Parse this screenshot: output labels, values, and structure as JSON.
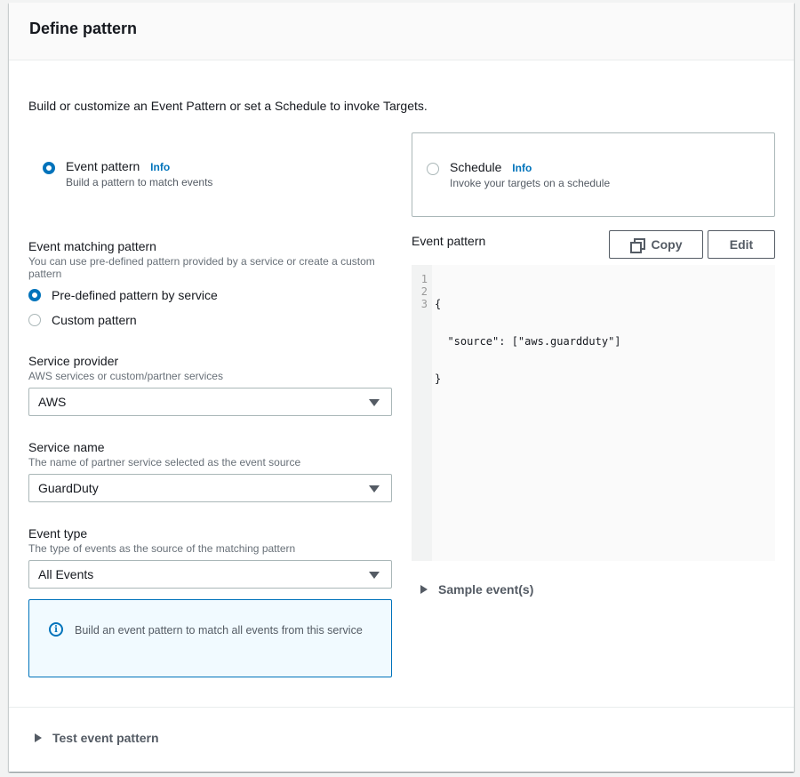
{
  "panel": {
    "title": "Define pattern",
    "intro": "Build or customize an Event Pattern or set a Schedule to invoke Targets."
  },
  "rule_type": {
    "options": [
      {
        "label": "Event pattern",
        "info": "Info",
        "description": "Build a pattern to match events",
        "selected": true
      },
      {
        "label": "Schedule",
        "info": "Info",
        "description": "Invoke your targets on a schedule",
        "selected": false
      }
    ]
  },
  "event_matching": {
    "label": "Event matching pattern",
    "description": "You can use pre-defined pattern provided by a service or create a custom pattern",
    "options": [
      {
        "label": "Pre-defined pattern by service",
        "selected": true
      },
      {
        "label": "Custom pattern",
        "selected": false
      }
    ]
  },
  "service_provider": {
    "label": "Service provider",
    "description": "AWS services or custom/partner services",
    "value": "AWS"
  },
  "service_name": {
    "label": "Service name",
    "description": "The name of partner service selected as the event source",
    "value": "GuardDuty"
  },
  "event_type": {
    "label": "Event type",
    "description": "The type of events as the source of the matching pattern",
    "value": "All Events"
  },
  "alert": {
    "icon": "info-icon",
    "text": "Build an event pattern to match all events from this service"
  },
  "event_pattern": {
    "label": "Event pattern",
    "copy_label": "Copy",
    "edit_label": "Edit",
    "line_numbers": [
      "1",
      "2",
      "3"
    ],
    "lines": [
      "{",
      "  \"source\": [\"aws.guardduty\"]",
      "}"
    ]
  },
  "sample_events": {
    "label": "Sample event(s)",
    "expanded": false
  },
  "test_pattern": {
    "label": "Test event pattern",
    "expanded": false
  },
  "colors": {
    "accent": "#0073bb",
    "alert_bg": "#f1faff",
    "text": "#16191f",
    "muted": "#545b64"
  }
}
